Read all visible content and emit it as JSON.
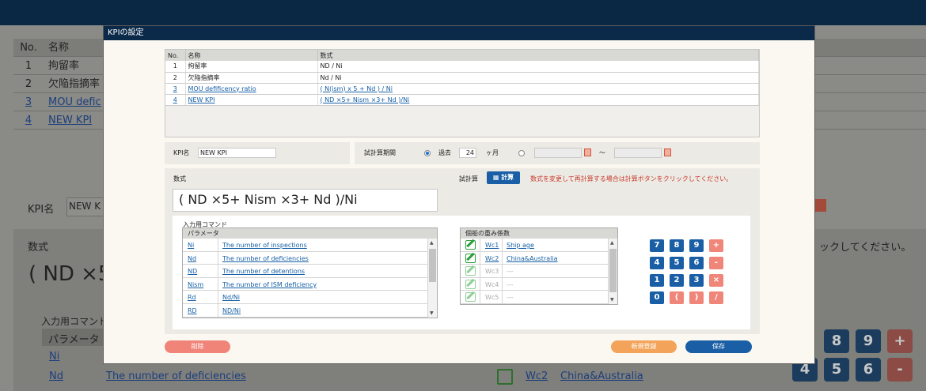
{
  "background": {
    "table_head": {
      "no": "No.",
      "name": "名称"
    },
    "rows": [
      {
        "no": "1",
        "name": "拘留率",
        "link": false
      },
      {
        "no": "2",
        "name": "欠陥指摘率",
        "link": false
      },
      {
        "no": "3",
        "name": "MOU defic",
        "link": true
      },
      {
        "no": "4",
        "name": "NEW KPI",
        "link": true
      }
    ],
    "kpi_label": "KPI名",
    "kpi_value": "NEW K",
    "formula_label": "数式",
    "formula": "( ND ×5",
    "cmd_label": "入力用コマンド",
    "param_head": "パラメータ",
    "ni": "Ni",
    "nd": "Nd",
    "nd_desc": "The number of deficiencies",
    "hint_tail": "ックしてください。",
    "wc2": "Wc2",
    "wc2_desc": "China&Australia",
    "keys_row1": [
      "8",
      "9",
      "+"
    ],
    "keys_row2": [
      "4",
      "5",
      "6",
      "-"
    ]
  },
  "modal": {
    "title": "KPIの設定",
    "kpi_table": {
      "headers": [
        "No.",
        "名称",
        "数式"
      ],
      "rows": [
        {
          "no": "1",
          "name": "拘留率",
          "formula": "ND / Ni",
          "link": false
        },
        {
          "no": "2",
          "name": "欠陥指摘率",
          "formula": "Nd / Ni",
          "link": false
        },
        {
          "no": "3",
          "name": "MOU defificency ratio",
          "formula": "( N(ism) x 5 + Nd ) / Ni",
          "link": true
        },
        {
          "no": "4",
          "name": "NEW KPI",
          "formula": "( ND ×5+ Nism ×3+ Nd )/Ni",
          "link": true
        }
      ]
    },
    "kpi_name_label": "KPI名",
    "kpi_name_value": "NEW KPI",
    "period_label": "試計算期間",
    "period_past": "過去",
    "period_value": "24",
    "period_unit": "ヶ月",
    "tilde": "〜",
    "formula_label": "数式",
    "calc_label": "試計算",
    "calc_button": "計算",
    "calc_hint": "数式を変更して再計算する場合は計算ボタンをクリックしてください。",
    "formula_value": "( ND ×5+ Nism ×3+ Nd )/Ni",
    "cmd_label": "入力用コマンド",
    "param_header": "パラメータ",
    "params": [
      {
        "key": "Ni",
        "desc": "The number of inspections"
      },
      {
        "key": "Nd",
        "desc": "The number of deficiencies"
      },
      {
        "key": "ND",
        "desc": "The number of detentions"
      },
      {
        "key": "Nism",
        "desc": "The number of ISM deficiency"
      },
      {
        "key": "Rd",
        "desc": "Nd/Ni"
      },
      {
        "key": "RD",
        "desc": "ND/Ni"
      }
    ],
    "weight_header": "個船の重み係数",
    "weights": [
      {
        "key": "Wc1",
        "desc": "Ship age",
        "enabled": true
      },
      {
        "key": "Wc2",
        "desc": "China&Australia",
        "enabled": true
      },
      {
        "key": "Wc3",
        "desc": "---",
        "enabled": false
      },
      {
        "key": "Wc4",
        "desc": "---",
        "enabled": false
      },
      {
        "key": "Wc5",
        "desc": "---",
        "enabled": false
      }
    ],
    "keypad": [
      [
        "7",
        "8",
        "9",
        "+"
      ],
      [
        "4",
        "5",
        "6",
        "-"
      ],
      [
        "1",
        "2",
        "3",
        "×"
      ],
      [
        "0",
        "(",
        ")",
        "/"
      ]
    ],
    "delete_button": "削除",
    "new_button": "新規登録",
    "save_button": "保存"
  },
  "colors": {
    "accent": "#1a5fa6",
    "danger": "#f08479",
    "warning": "#f4a45a",
    "titlebar": "#0b2a4a"
  }
}
